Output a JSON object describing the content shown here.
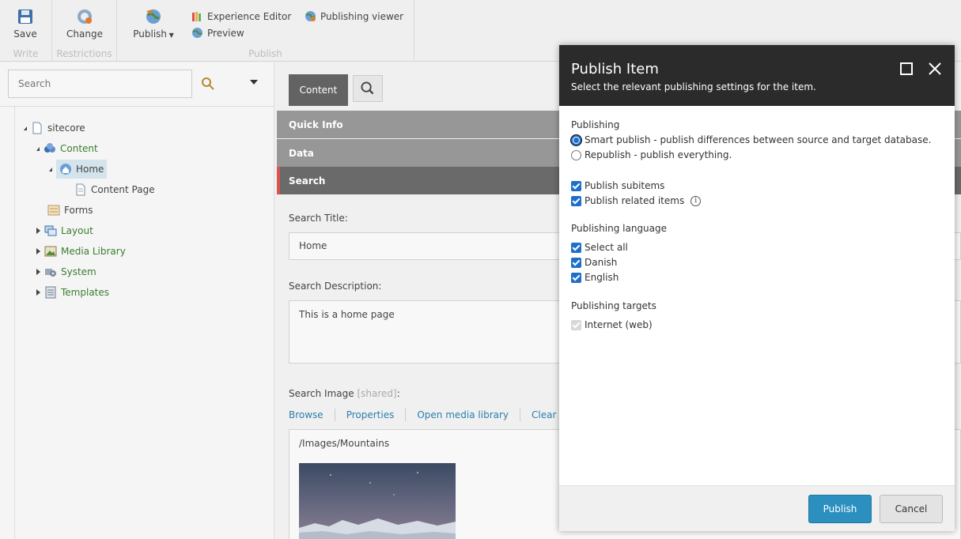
{
  "ribbon": {
    "write": {
      "save_label": "Save",
      "group_label": "Write"
    },
    "restrictions": {
      "change_label": "Change",
      "group_label": "Restrictions"
    },
    "publish": {
      "publish_label": "Publish",
      "experience_editor_label": "Experience Editor",
      "preview_label": "Preview",
      "publishing_viewer_label": "Publishing viewer",
      "group_label": "Publish"
    }
  },
  "tree": {
    "search_placeholder": "Search",
    "items": [
      {
        "label": "sitecore",
        "icon": "page-icon"
      },
      {
        "label": "Content",
        "icon": "content-icon"
      },
      {
        "label": "Home",
        "icon": "home-icon"
      },
      {
        "label": "Content Page",
        "icon": "page-icon"
      },
      {
        "label": "Forms",
        "icon": "forms-icon"
      },
      {
        "label": "Layout",
        "icon": "layout-icon"
      },
      {
        "label": "Media Library",
        "icon": "media-icon"
      },
      {
        "label": "System",
        "icon": "system-icon"
      },
      {
        "label": "Templates",
        "icon": "templates-icon"
      }
    ]
  },
  "editor": {
    "tab_label": "Content",
    "sections": [
      "Quick Info",
      "Data",
      "Search"
    ],
    "search_title_label": "Search Title:",
    "search_title_value": "Home",
    "search_description_label": "Search Description:",
    "search_description_value": "This is a home page",
    "search_image_label": "Search Image",
    "search_image_shared": "[shared]",
    "search_image_colon": ":",
    "image_links": [
      "Browse",
      "Properties",
      "Open media library",
      "Clear"
    ],
    "image_path": "/Images/Mountains"
  },
  "dialog": {
    "title": "Publish Item",
    "subtitle": "Select the relevant publishing settings for the item.",
    "publishing_heading": "Publishing",
    "smart_publish": "Smart publish - publish differences between source and target database.",
    "republish": "Republish - publish everything.",
    "publish_subitems": "Publish subitems",
    "publish_related": "Publish related items",
    "language_heading": "Publishing language",
    "languages": [
      "Select all",
      "Danish",
      "English"
    ],
    "targets_heading": "Publishing targets",
    "targets": [
      "Internet (web)"
    ],
    "publish_button": "Publish",
    "cancel_button": "Cancel"
  },
  "colors": {
    "accent_blue": "#2b8fc0",
    "tree_green": "#3a7d2d",
    "dialog_header": "#2b2b2b",
    "active_section_marker": "#d9534f"
  }
}
